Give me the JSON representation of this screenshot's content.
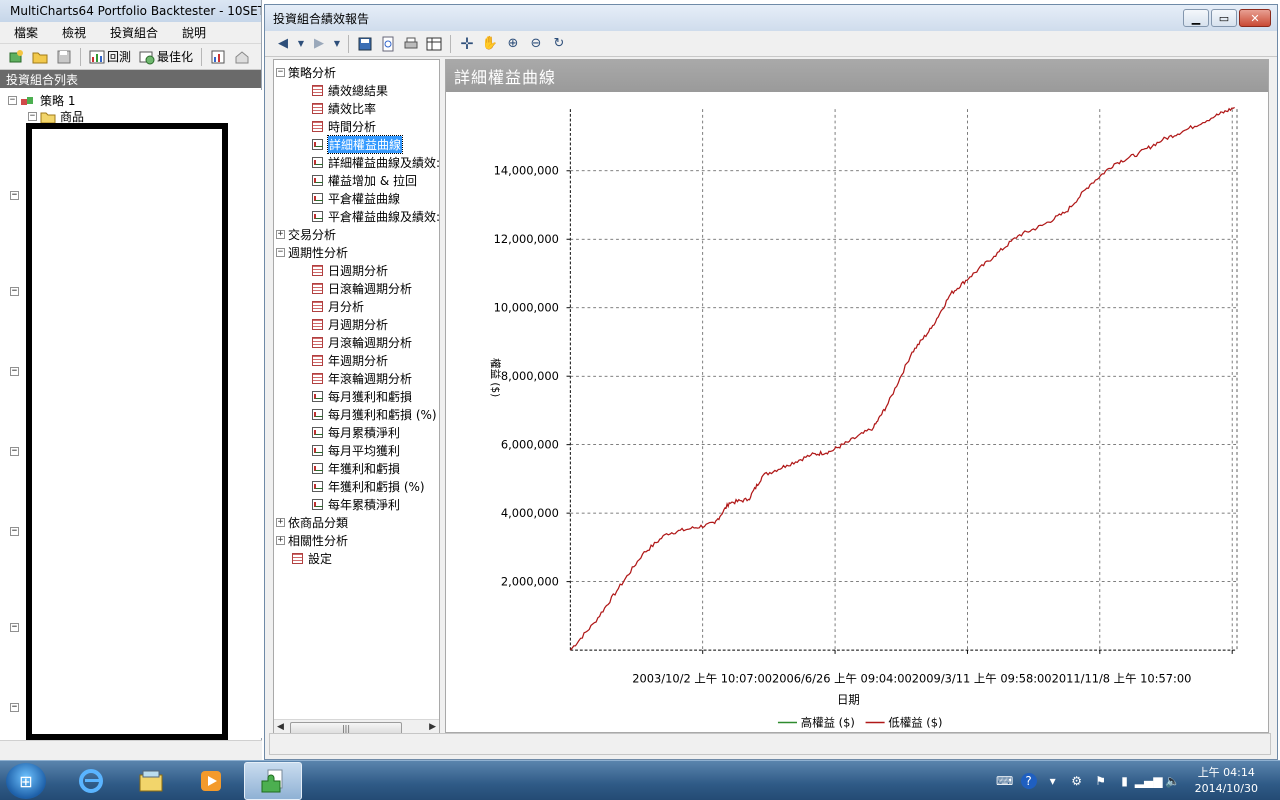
{
  "main_window": {
    "title": "MultiCharts64 Portfolio Backtester - 10SET",
    "menu": [
      "檔案",
      "檢視",
      "投資組合",
      "說明"
    ],
    "toolbar": {
      "backtest_label": "回測",
      "optimize_label": "最佳化"
    },
    "panel_header": "投資組合列表",
    "tree": {
      "strategy_label": "策略 1",
      "symbol_label": "商品"
    }
  },
  "report_window": {
    "title": "投資組合績效報告",
    "nav": {
      "items": [
        {
          "label": "策略分析",
          "level": 0,
          "expander": "−",
          "icon": "none"
        },
        {
          "label": "績效總結果",
          "level": 1,
          "icon": "doc"
        },
        {
          "label": "績效比率",
          "level": 1,
          "icon": "doc"
        },
        {
          "label": "時間分析",
          "level": 1,
          "icon": "doc"
        },
        {
          "label": "詳細權益曲線",
          "level": 1,
          "icon": "chart",
          "selected": true
        },
        {
          "label": "詳細權益曲線及績效:",
          "level": 1,
          "icon": "chart"
        },
        {
          "label": "權益增加 & 拉回",
          "level": 1,
          "icon": "chart"
        },
        {
          "label": "平倉權益曲線",
          "level": 1,
          "icon": "chart"
        },
        {
          "label": "平倉權益曲線及績效:",
          "level": 1,
          "icon": "chart"
        },
        {
          "label": "交易分析",
          "level": 0,
          "expander": "+",
          "icon": "none"
        },
        {
          "label": "週期性分析",
          "level": 0,
          "expander": "−",
          "icon": "none"
        },
        {
          "label": "日週期分析",
          "level": 1,
          "icon": "doc"
        },
        {
          "label": "日滾輪週期分析",
          "level": 1,
          "icon": "doc"
        },
        {
          "label": "月分析",
          "level": 1,
          "icon": "doc"
        },
        {
          "label": "月週期分析",
          "level": 1,
          "icon": "doc"
        },
        {
          "label": "月滾輪週期分析",
          "level": 1,
          "icon": "doc"
        },
        {
          "label": "年週期分析",
          "level": 1,
          "icon": "doc"
        },
        {
          "label": "年滾輪週期分析",
          "level": 1,
          "icon": "doc"
        },
        {
          "label": "每月獲利和虧損",
          "level": 1,
          "icon": "chart"
        },
        {
          "label": "每月獲利和虧損 (%)",
          "level": 1,
          "icon": "chart"
        },
        {
          "label": "每月累積淨利",
          "level": 1,
          "icon": "chart"
        },
        {
          "label": "每月平均獲利",
          "level": 1,
          "icon": "chart"
        },
        {
          "label": "年獲利和虧損",
          "level": 1,
          "icon": "chart"
        },
        {
          "label": "年獲利和虧損 (%)",
          "level": 1,
          "icon": "chart"
        },
        {
          "label": "每年累積淨利",
          "level": 1,
          "icon": "chart"
        },
        {
          "label": "依商品分類",
          "level": 0,
          "expander": "+",
          "icon": "none"
        },
        {
          "label": "相關性分析",
          "level": 0,
          "expander": "+",
          "icon": "none"
        },
        {
          "label": "設定",
          "level": 0,
          "icon": "doc"
        }
      ]
    },
    "chart_header": "詳細權益曲線"
  },
  "chart_data": {
    "type": "line",
    "title": "詳細權益曲線",
    "xlabel": "日期",
    "ylabel": "權益 ($)",
    "x_tick_labels": [
      "2003/10/2 上午 10:07:00",
      "2006/6/26 上午 09:04:00",
      "2009/3/11 上午 09:58:00",
      "2011/11/8 上午 10:57:00"
    ],
    "x_range": [
      "2001/1",
      "2014/10"
    ],
    "ylim": [
      0,
      15800000
    ],
    "y_ticks": [
      2000000,
      4000000,
      6000000,
      8000000,
      10000000,
      12000000,
      14000000
    ],
    "y_tick_labels": [
      "2,000,000",
      "4,000,000",
      "6,000,000",
      "8,000,000",
      "10,000,000",
      "12,000,000",
      "14,000,000"
    ],
    "grid": true,
    "legend_position": "bottom",
    "series": [
      {
        "name": "高權益 ($)",
        "color": "#2e8b2e",
        "x": [],
        "values": []
      },
      {
        "name": "低權益 ($)",
        "color": "#b01818",
        "x": [
          2001.0,
          2001.5,
          2002.0,
          2002.5,
          2003.0,
          2003.5,
          2004.0,
          2004.3,
          2004.7,
          2005.0,
          2005.5,
          2006.0,
          2006.4,
          2006.8,
          2007.3,
          2007.6,
          2008.1,
          2008.5,
          2008.9,
          2009.3,
          2009.8,
          2010.3,
          2010.8,
          2011.3,
          2011.8,
          2012.3,
          2012.8,
          2013.3,
          2013.8,
          2014.4,
          2014.8
        ],
        "values": [
          0,
          800000,
          1800000,
          2800000,
          3400000,
          3550000,
          3700000,
          4300000,
          4400000,
          5100000,
          5400000,
          5700000,
          5800000,
          6100000,
          6500000,
          7200000,
          8700000,
          9400000,
          10400000,
          10900000,
          11500000,
          12100000,
          12400000,
          12800000,
          13600000,
          14200000,
          14500000,
          14900000,
          15200000,
          15600000,
          15850000
        ]
      }
    ]
  },
  "taskbar": {
    "clock_time": "上午 04:14",
    "clock_date": "2014/10/30"
  },
  "colors": {
    "accent": "#3399ff",
    "titlebar": "#cfdcec",
    "close_button": "#c94a34",
    "taskbar": "#2f5a86"
  }
}
